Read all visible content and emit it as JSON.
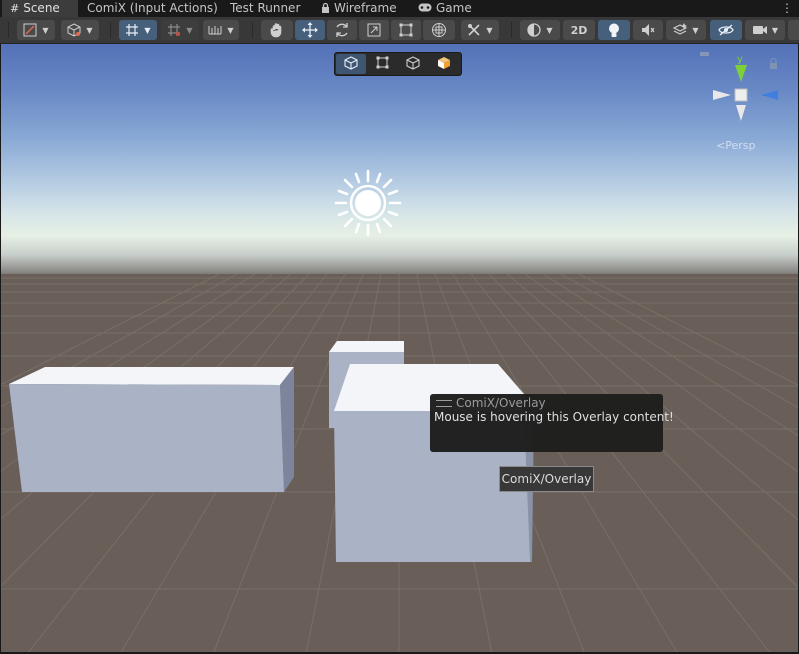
{
  "tabs": [
    {
      "label": "Scene",
      "icon": "grid-icon",
      "active": true
    },
    {
      "label": "ComiX (Input Actions)",
      "active": false
    },
    {
      "label": "Test Runner",
      "active": false
    },
    {
      "label": "Wireframe",
      "icon": "lock-icon",
      "active": false
    },
    {
      "label": "Game",
      "icon": "gamepad-icon",
      "active": false
    }
  ],
  "tab_menu_glyph": "⋮",
  "toolbar": {
    "mode_2d_label": "2D",
    "icons": [
      "draw-mode-icon",
      "shading-cube-icon",
      "grid-snap-icon",
      "increment-snap-icon",
      "ruler-icon",
      "hand-tool-icon",
      "move-tool-icon",
      "rotate-tool-icon",
      "scale-tool-icon",
      "rect-tool-icon",
      "transform-tool-icon",
      "custom-tool-icon",
      "render-mode-icon",
      "lighting-icon",
      "audio-mute-icon",
      "effects-icon",
      "visibility-icon",
      "camera-icon",
      "gizmos-icon"
    ]
  },
  "overlay_toolbar": {
    "buttons": [
      "cube-icon",
      "rect-icon",
      "cube-outline-icon",
      "cube-orange-icon"
    ],
    "selected_index": 0
  },
  "gizmo": {
    "axis_y_label": "y",
    "persp_label": "Persp",
    "persp_glyph": "<"
  },
  "overlay_panel": {
    "title": "ComiX/Overlay",
    "body": "Mouse is hovering this Overlay content!"
  },
  "tooltip": {
    "text": "ComiX/Overlay"
  },
  "colors": {
    "tab_bg": "#191919",
    "toolbar_bg": "#383838",
    "selected_button": "#46607c",
    "ground": "#695f58",
    "gizmo_y": "#7ed038",
    "gizmo_z": "#3f7fe0"
  }
}
